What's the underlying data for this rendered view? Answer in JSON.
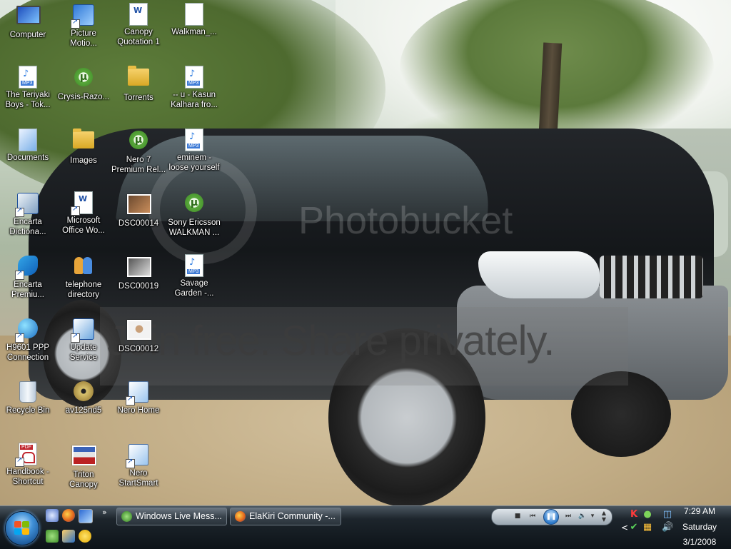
{
  "desktop": {
    "icons": [
      {
        "label": "Computer"
      },
      {
        "label": "Picture\nMotio..."
      },
      {
        "label": "Canopy\nQuotation 1"
      },
      {
        "label": "Walkman_..."
      },
      {
        "label": "The Teriyaki\nBoys - Tok..."
      },
      {
        "label": "Crysis-Razo..."
      },
      {
        "label": "Torrents"
      },
      {
        "label": "-- u - Kasun\nKalhara fro..."
      },
      {
        "label": "Documents"
      },
      {
        "label": "Images"
      },
      {
        "label": "Nero 7\nPremium Rel..."
      },
      {
        "label": "eminem -\nloose yourself"
      },
      {
        "label": "Encarta\nDictiona..."
      },
      {
        "label": "Microsoft\nOffice Wo..."
      },
      {
        "label": "DSC00014"
      },
      {
        "label": "Sony Ericsson\nWALKMAN ..."
      },
      {
        "label": "Encarta\nPremiu..."
      },
      {
        "label": "telephone\ndirectory"
      },
      {
        "label": "DSC00019"
      },
      {
        "label": "Savage\nGarden -..."
      },
      {
        "label": "H9601 PPP\nConnection"
      },
      {
        "label": "Update\nService"
      },
      {
        "label": "DSC00012"
      },
      {
        "label": "Recycle Bin"
      },
      {
        "label": "av125nd5"
      },
      {
        "label": "Nero Home"
      },
      {
        "label": "Handbook -\nShortcut"
      },
      {
        "label": "Triton\nCanopy"
      },
      {
        "label": "Nero\nStartSmart"
      }
    ]
  },
  "wallpaper": {
    "watermark_logo": "Photobucket",
    "watermark_slogan": "Join free. Share privately."
  },
  "taskbar": {
    "quick_launch_chevron": "»",
    "tasks": [
      {
        "label": "Windows Live Mess..."
      },
      {
        "label": "ElaKiri Community -..."
      }
    ],
    "tray_chevron": "<",
    "clock": {
      "time": "7:29 AM",
      "day": "Saturday",
      "date": "3/1/2008"
    }
  }
}
